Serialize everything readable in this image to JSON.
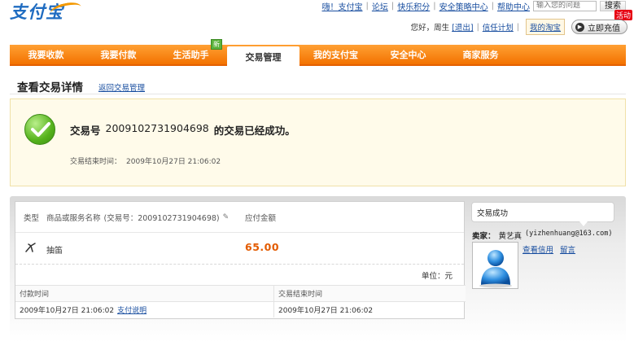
{
  "header": {
    "logo_text": "支付宝",
    "top_links": [
      "嗨！支付宝",
      "论坛",
      "快乐积分",
      "安全策略中心",
      "帮助中心"
    ],
    "search_placeholder": "输入您的问题",
    "search_button": "搜索",
    "greeting": "您好，周生",
    "logout_label": "[退出]",
    "trust_plan": "信任计划",
    "my_taobao": "我的淘宝",
    "recharge_label": "立即充值",
    "promo_tag": "活动"
  },
  "nav": {
    "items": [
      {
        "label": "我要收款",
        "active": false
      },
      {
        "label": "我要付款",
        "active": false
      },
      {
        "label": "生活助手",
        "active": false,
        "badge": "新"
      },
      {
        "label": "交易管理",
        "active": true
      },
      {
        "label": "我的支付宝",
        "active": false
      },
      {
        "label": "安全中心",
        "active": false
      },
      {
        "label": "商家服务",
        "active": false
      }
    ]
  },
  "page": {
    "title": "查看交易详情",
    "back_link": "返回交易管理"
  },
  "success": {
    "prefix": "交易号",
    "trade_no": "2009102731904698",
    "suffix": "的交易已经成功。",
    "end_time_label": "交易结束时间：",
    "end_time_value": "2009年10月27日 21:06:02"
  },
  "order": {
    "col_type": "类型",
    "col_name": "商品或服务名称",
    "col_name_trade": "(交易号：2009102731904698)",
    "col_amount": "应付金额",
    "item_name": "抽笛",
    "item_amount": "65.00",
    "unit": "单位：元",
    "pay_time_label": "付款时间",
    "end_time_label": "交易结束时间",
    "pay_time_value": "2009年10月27日 21:06:02",
    "pay_note_link": "支付说明",
    "end_time_value": "2009年10月27日 21:06:02"
  },
  "seller": {
    "status": "交易成功",
    "label": "卖家：",
    "name": "黄艺真",
    "email": "(yizhenhuang@163.com)",
    "credit_link": "查看信用",
    "message_link": "留言"
  },
  "colors": {
    "nav_orange": "#f37200",
    "amount_orange": "#e35b00",
    "link_blue": "#1a4fa0",
    "success_bg": "#fffbea",
    "success_green": "#55b21c"
  }
}
